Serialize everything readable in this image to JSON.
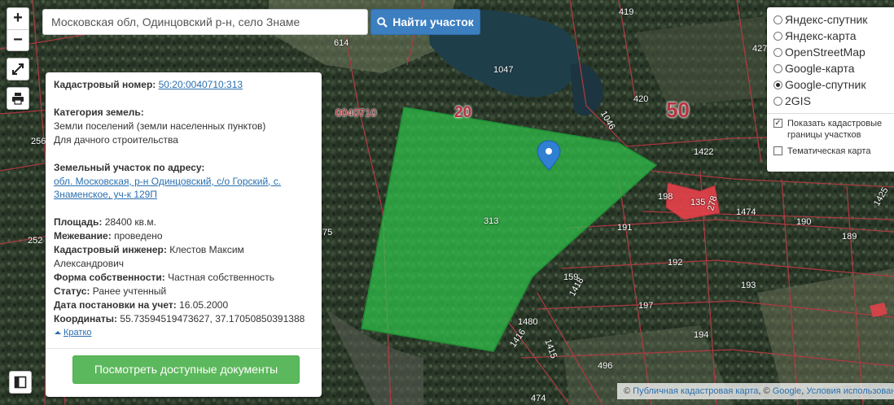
{
  "search": {
    "value": "Московская обл, Одинцовский р-н, село Знаме",
    "button_label": "Найти участок",
    "button_icon": "search-icon"
  },
  "controls": {
    "zoom_in": "+",
    "zoom_out": "−",
    "fullscreen_icon": "expand-icon",
    "print_icon": "printer-icon",
    "sidebar_icon": "panel-icon"
  },
  "info": {
    "cad_num_label": "Кадастровый номер:",
    "cad_num_value": "50:20:0040710:313",
    "category_label": "Категория земель:",
    "category_line1": "Земли поселений (земли населенных пунктов)",
    "category_line2": "Для дачного строительства",
    "address_label": "Земельный участок по адресу:",
    "address_line1": "обл. Московская, р-н Одинцовский, с/о Горский, с.",
    "address_line2": "Знаменское, уч-к 129П",
    "area_label": "Площадь:",
    "area_value": "28400 кв.м.",
    "survey_label": "Межевание:",
    "survey_value": "проведено",
    "engineer_label": "Кадастровый инженер:",
    "engineer_value1": "Клестов Максим",
    "engineer_value2": "Александрович",
    "ownership_label": "Форма собственности:",
    "ownership_value": "Частная собственность",
    "status_label": "Статус:",
    "status_value": "Ранее учтенный",
    "date_label": "Дата постановки на учет:",
    "date_value": "16.05.2000",
    "coords_label": "Координаты:",
    "coords_value": "55.73594519473627, 37.17050850391388",
    "brief_label": "Кратко",
    "docs_button": "Посмотреть доступные документы"
  },
  "layers": {
    "options": [
      "Яндекс-спутник",
      "Яндекс-карта",
      "OpenStreetMap",
      "Google-карта",
      "Google-спутник",
      "2GIS"
    ],
    "selected": "Google-спутник",
    "show_borders_label": "Показать кадастровые границы участков",
    "show_borders_checked": true,
    "thematic_label": "Тематическая карта",
    "thematic_checked": false
  },
  "map": {
    "district_label": "50",
    "quarter_label": "20",
    "block_label": "0040710",
    "parcel_labels": [
      "419",
      "614",
      "1047",
      "427",
      "420",
      "1046",
      "1422",
      "198",
      "135",
      "278",
      "1474",
      "190",
      "189",
      "191",
      "192",
      "193",
      "197",
      "194",
      "159",
      "1418",
      "1480",
      "1416",
      "1415",
      "496",
      "474",
      "256",
      "252",
      "75",
      "313",
      "1425"
    ],
    "colors": {
      "parcel_fill": "#2fc24a",
      "border": "#a8323a",
      "pin": "#2f7fd3",
      "building": "#e8414a"
    }
  },
  "attribution": {
    "prefix": "©",
    "link1": "Публичная кадастровая карта",
    "mid": ", ©",
    "link2": "Google",
    "link3": "Условия использования"
  }
}
